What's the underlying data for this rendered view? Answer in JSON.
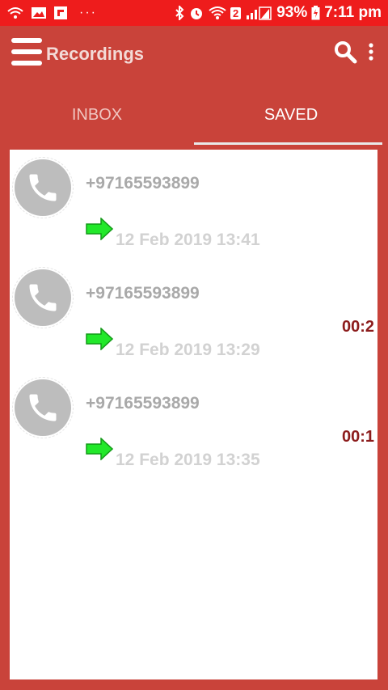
{
  "status_bar": {
    "battery": "93%",
    "time": "7:11 pm",
    "dots": "···",
    "sim_badge": "2"
  },
  "app_bar": {
    "title": "Recordings"
  },
  "tabs": [
    {
      "label": "INBOX",
      "selected": false
    },
    {
      "label": "SAVED",
      "selected": true
    }
  ],
  "colors": {
    "status_bar": "#ee1c1c",
    "app_background": "#c9433a",
    "duration_text": "#8c1c1c",
    "arrow": "#22e82a"
  },
  "recordings": [
    {
      "number": "+97165593899",
      "date": "12 Feb 2019 13:41",
      "duration": "",
      "direction_icon": "outgoing-arrow-icon"
    },
    {
      "number": "+97165593899",
      "date": "12 Feb 2019 13:29",
      "duration": "00:2",
      "direction_icon": "outgoing-arrow-icon"
    },
    {
      "number": "+97165593899",
      "date": "12 Feb 2019 13:35",
      "duration": "00:1",
      "direction_icon": "outgoing-arrow-icon"
    }
  ]
}
